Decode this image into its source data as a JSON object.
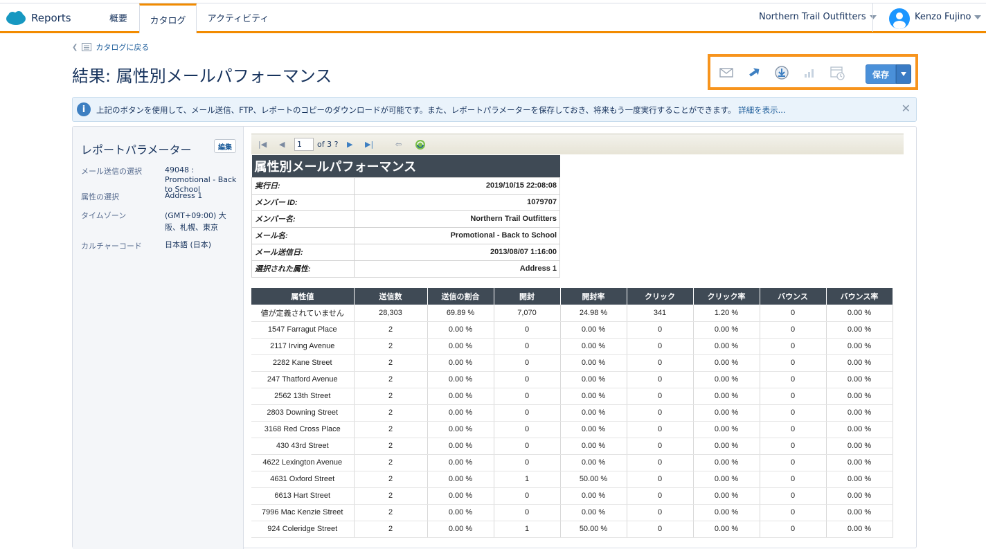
{
  "nav": {
    "app_name": "Reports",
    "tabs": [
      "概要",
      "カタログ",
      "アクティビティ"
    ],
    "org": "Northern Trail Outfitters",
    "user": "Kenzo Fujino"
  },
  "header": {
    "back_label": "カタログに戻る",
    "title": "結果: 属性別メールパフォーマンス",
    "save_label": "保存"
  },
  "info": {
    "text": "上記のボタンを使用して、メール送信、FTP、レポートのコピーのダウンロードが可能です。また、レポートパラメーターを保存しておき、将来もう一度実行することができます。",
    "link": "詳細を表示..."
  },
  "sidebar": {
    "title": "レポートパラメーター",
    "edit_label": "編集",
    "params": [
      {
        "label": "メール送信の選択",
        "value": "49048 : Promotional - Back to School"
      },
      {
        "label": "属性の選択",
        "value": "Address 1"
      },
      {
        "label": "タイムゾーン",
        "value": "(GMT+09:00) 大阪、札幌、東京"
      },
      {
        "label": "カルチャーコード",
        "value": "日本語 (日本)"
      }
    ]
  },
  "viewer": {
    "page_value": "1",
    "page_of": "of 3 ?"
  },
  "report": {
    "title": "属性別メールパフォーマンス",
    "meta": [
      {
        "k": "実行日:",
        "v": "2019/10/15 22:08:08"
      },
      {
        "k": "メンバー ID:",
        "v": "1079707"
      },
      {
        "k": "メンバー名:",
        "v": "Northern Trail Outfitters"
      },
      {
        "k": "メール名:",
        "v": "Promotional - Back to School"
      },
      {
        "k": "メール送信日:",
        "v": "2013/08/07 1:16:00"
      },
      {
        "k": "選択された属性:",
        "v": "Address 1"
      }
    ],
    "columns": [
      "属性値",
      "送信数",
      "送信の割合",
      "開封",
      "開封率",
      "クリック",
      "クリック率",
      "バウンス",
      "バウンス率"
    ],
    "rows": [
      [
        "値が定義されていません",
        "28,303",
        "69.89 %",
        "7,070",
        "24.98 %",
        "341",
        "1.20 %",
        "0",
        "0.00 %"
      ],
      [
        "1547 Farragut Place",
        "2",
        "0.00 %",
        "0",
        "0.00 %",
        "0",
        "0.00 %",
        "0",
        "0.00 %"
      ],
      [
        "2117 Irving Avenue",
        "2",
        "0.00 %",
        "0",
        "0.00 %",
        "0",
        "0.00 %",
        "0",
        "0.00 %"
      ],
      [
        "2282 Kane Street",
        "2",
        "0.00 %",
        "0",
        "0.00 %",
        "0",
        "0.00 %",
        "0",
        "0.00 %"
      ],
      [
        "247 Thatford Avenue",
        "2",
        "0.00 %",
        "0",
        "0.00 %",
        "0",
        "0.00 %",
        "0",
        "0.00 %"
      ],
      [
        "2562 13th Street",
        "2",
        "0.00 %",
        "0",
        "0.00 %",
        "0",
        "0.00 %",
        "0",
        "0.00 %"
      ],
      [
        "2803 Downing Street",
        "2",
        "0.00 %",
        "0",
        "0.00 %",
        "0",
        "0.00 %",
        "0",
        "0.00 %"
      ],
      [
        "3168 Red Cross Place",
        "2",
        "0.00 %",
        "0",
        "0.00 %",
        "0",
        "0.00 %",
        "0",
        "0.00 %"
      ],
      [
        "430 43rd Street",
        "2",
        "0.00 %",
        "0",
        "0.00 %",
        "0",
        "0.00 %",
        "0",
        "0.00 %"
      ],
      [
        "4622 Lexington Avenue",
        "2",
        "0.00 %",
        "0",
        "0.00 %",
        "0",
        "0.00 %",
        "0",
        "0.00 %"
      ],
      [
        "4631 Oxford Street",
        "2",
        "0.00 %",
        "1",
        "50.00 %",
        "0",
        "0.00 %",
        "0",
        "0.00 %"
      ],
      [
        "6613 Hart Street",
        "2",
        "0.00 %",
        "0",
        "0.00 %",
        "0",
        "0.00 %",
        "0",
        "0.00 %"
      ],
      [
        "7996 Mac Kenzie Street",
        "2",
        "0.00 %",
        "0",
        "0.00 %",
        "0",
        "0.00 %",
        "0",
        "0.00 %"
      ],
      [
        "924 Coleridge Street",
        "2",
        "0.00 %",
        "1",
        "50.00 %",
        "0",
        "0.00 %",
        "0",
        "0.00 %"
      ]
    ]
  },
  "colors": {
    "accent": "#f28b00",
    "header_bg": "#3f4a55",
    "brand": "#1798c1"
  }
}
